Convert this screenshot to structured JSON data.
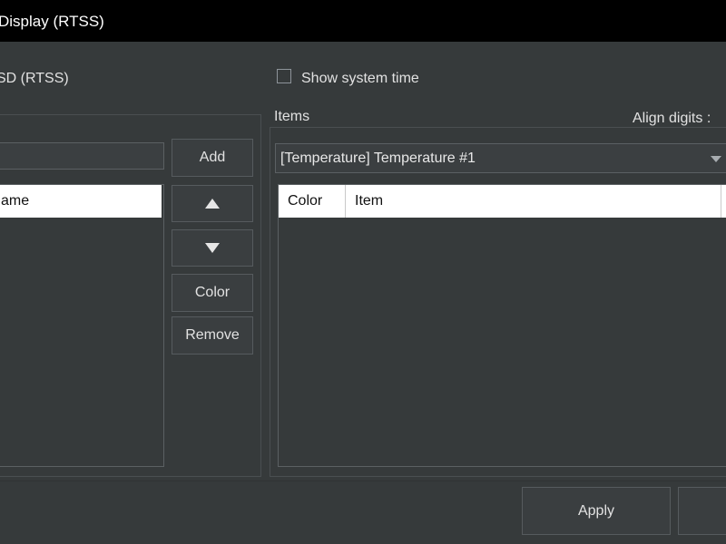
{
  "window": {
    "title": "Display (RTSS)"
  },
  "left_panel": {
    "header": "SD (RTSS)",
    "list_column": "ame"
  },
  "right_panel": {
    "show_system_time_label": "Show system time",
    "show_system_time_checked": false,
    "items_label": "Items",
    "align_digits_label": "Align digits :",
    "items_combo_value": "[Temperature] Temperature #1",
    "items_table_columns": [
      "Color",
      "Item"
    ]
  },
  "buttons": {
    "add": "Add",
    "move_up_icon": "triangle-up-icon",
    "move_down_icon": "triangle-down-icon",
    "color": "Color",
    "remove": "Remove",
    "apply": "Apply"
  }
}
